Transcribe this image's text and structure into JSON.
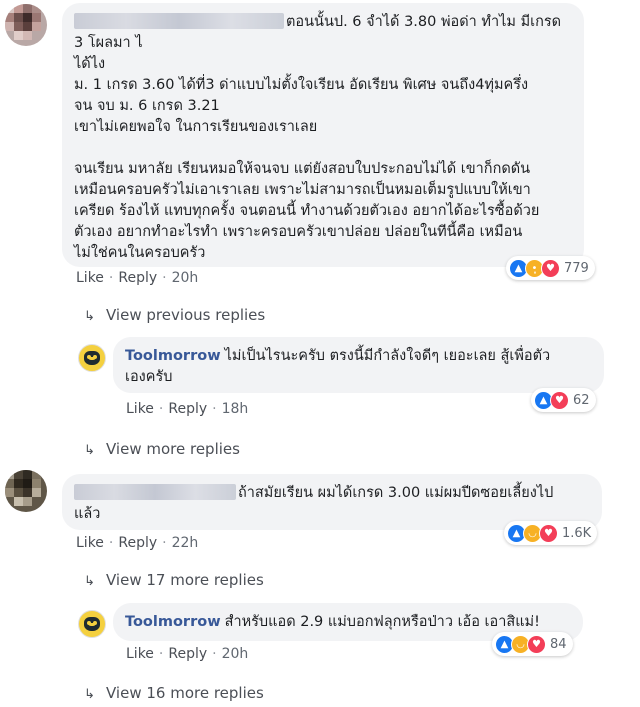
{
  "comments": [
    {
      "author_blurred": true,
      "text_lines": [
        "ตอนนั้นป. 6 จำได้ 3.80 พ่อด่า ทำไม มีเกรด",
        "3 โผลมา ไ",
        "ได้ไง",
        "ม. 1 เกรด 3.60 ได้ที่3 ด่าแบบไม่ตั้งใจเรียน อัดเรียน พิเศษ จนถึง4ทุ่มครึ่ง",
        "จน จบ ม. 6 เกรด 3.21",
        "เขาไม่เคยพอใจ ในการเรียนของเราเลย",
        "",
        "จนเรียน มหาลัย เรียนหมอให้จนจบ แต่ยังสอบใบประกอบไม่ได้ เขาก็กดดัน",
        "เหมือนครอบครัวไม่เอาเราเลย เพราะไม่สามารถเป็นหมอเต็มรูปแบบให้เขา",
        "เครียด ร้องไห้ แทบทุกครั้ง จนตอนนี้ ทำงานด้วยตัวเอง อยากได้อะไรซื้อด้วย",
        "ตัวเอง อยากทำอะไรทำ เพราะครอบครัวเขาปล่อย ปล่อยในทีนี้คือ เหมือน",
        "ไม่ใช่คนในครอบครัว"
      ],
      "like": "Like",
      "reply": "Reply",
      "time": "20h",
      "reactions": [
        "like",
        "sad",
        "love"
      ],
      "reaction_count": "779",
      "view_previous": "View previous replies",
      "reply_item": {
        "author": "Toolmorrow",
        "text_lines": [
          "ไม่เป็นไรนะครับ ตรงนี้มีกำลังใจดีๆ เยอะเลย สู้เพื่อตัว",
          "เองครับ"
        ],
        "like": "Like",
        "reply": "Reply",
        "time": "18h",
        "reactions": [
          "like",
          "love"
        ],
        "reaction_count": "62"
      },
      "view_more": "View more replies"
    },
    {
      "author_blurred": true,
      "text_lines": [
        "ถ้าสมัยเรียน ผมได้เกรด 3.00 แม่ผมปีดซอยเลี้ยงไป",
        "แล้ว"
      ],
      "like": "Like",
      "reply": "Reply",
      "time": "22h",
      "reactions": [
        "like",
        "haha",
        "love"
      ],
      "reaction_count": "1.6K",
      "view_more": "View 17 more replies",
      "reply_item": {
        "author": "Toolmorrow",
        "text_lines": [
          "สำหรับแอด 2.9 แม่บอกฟลุกหรือป่าว เอ้อ เอาสิแม่!"
        ],
        "like": "Like",
        "reply": "Reply",
        "time": "20h",
        "reactions": [
          "like",
          "haha",
          "love"
        ],
        "reaction_count": "84"
      },
      "view_more_2": "View 16 more replies"
    }
  ],
  "icons": {
    "reply_arrow": "↳",
    "like": "👍",
    "love": "♥",
    "sad": "😢",
    "haha": "😆"
  },
  "colors": {
    "bubble_bg": "#f2f3f5",
    "name": "#385898",
    "like": "#1877f2",
    "love": "#f33e58",
    "yellow": "#f7b125"
  }
}
